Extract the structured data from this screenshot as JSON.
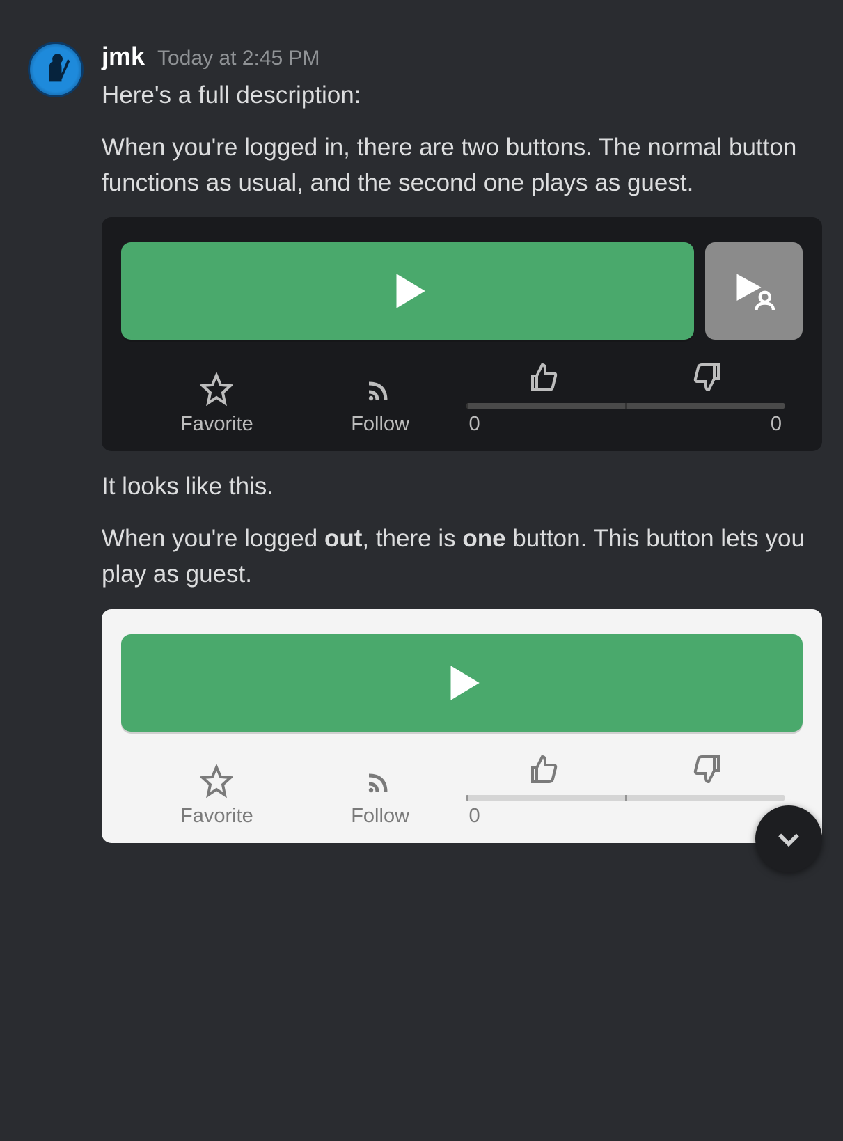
{
  "message": {
    "author": "jmk",
    "timestamp": "Today at 2:45 PM",
    "line1": "Here's a full description:",
    "line2": "When you're logged in, there are two buttons. The normal button functions as usual, and the second one plays as guest.",
    "line3": "It looks like this.",
    "line4_pre": "When you're logged ",
    "line4_b1": "out",
    "line4_mid": ", there is ",
    "line4_b2": "one",
    "line4_post": " button. This button lets you play as guest."
  },
  "embed_dark": {
    "favorite_label": "Favorite",
    "follow_label": "Follow",
    "like_count": "0",
    "dislike_count": "0"
  },
  "embed_light": {
    "favorite_label": "Favorite",
    "follow_label": "Follow",
    "like_count": "0"
  }
}
